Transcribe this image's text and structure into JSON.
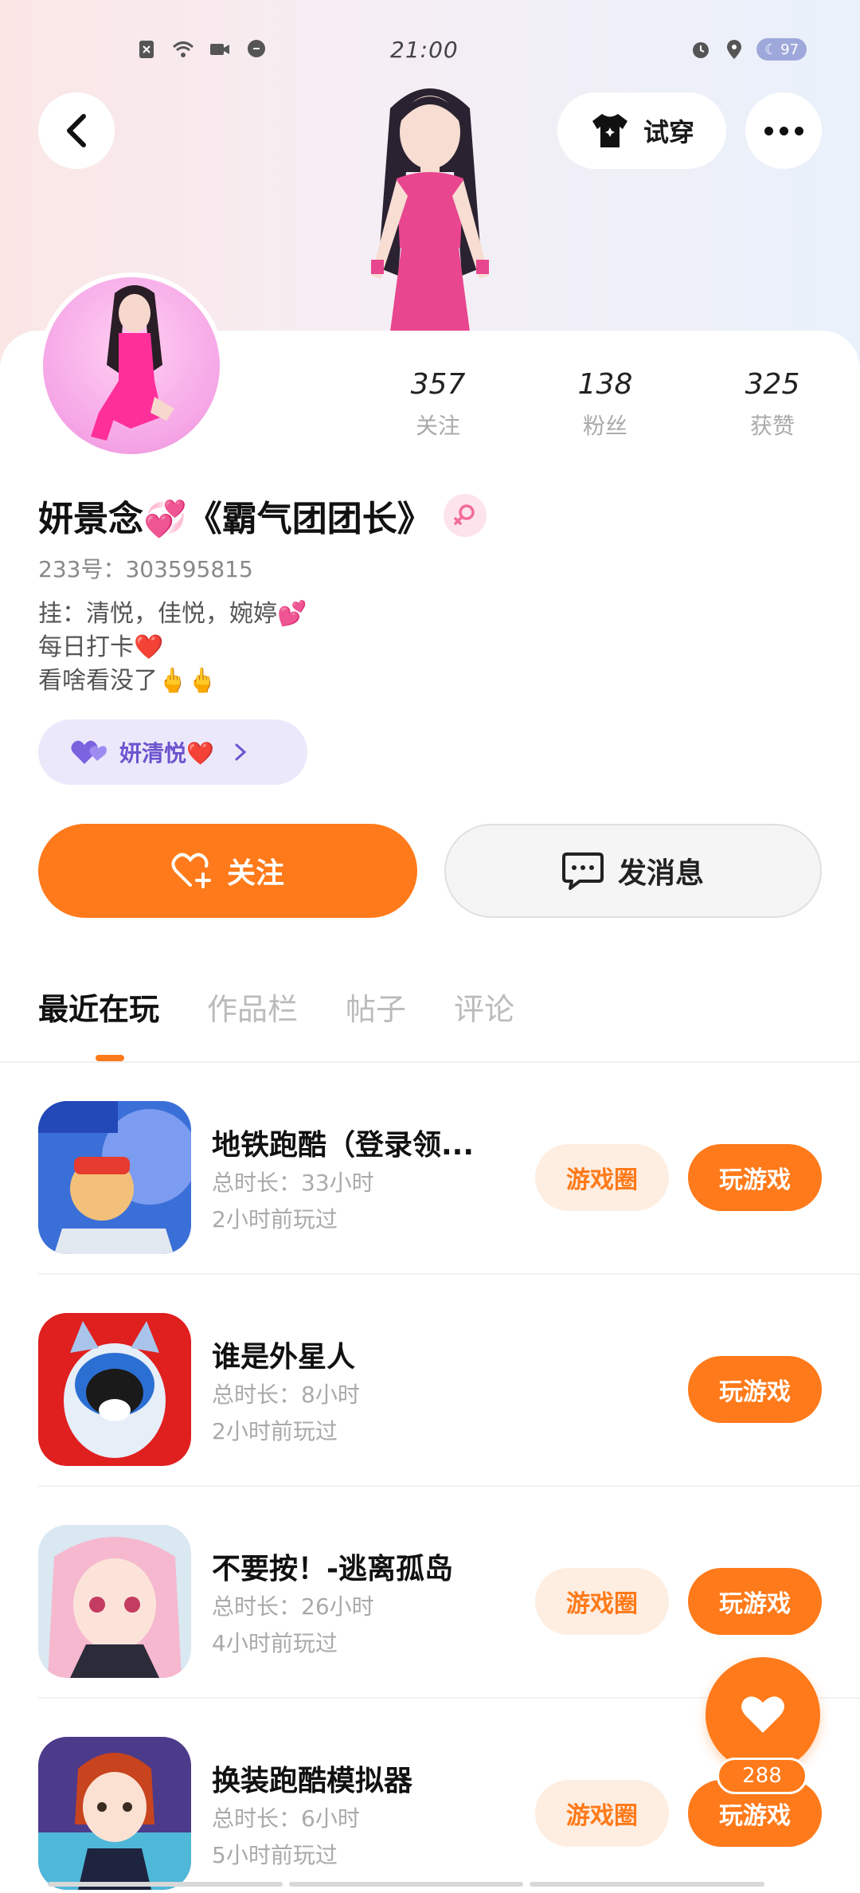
{
  "status_bar": {
    "time": "21:00",
    "battery": "97",
    "left_icons": [
      "sim-off-icon",
      "wifi-icon",
      "video-icon",
      "chat-bubble-icon"
    ],
    "right_icons": [
      "alarm-icon",
      "location-icon",
      "moon-battery-icon"
    ]
  },
  "header": {
    "tryon_label": "试穿"
  },
  "profile": {
    "name": "妍景念💞《霸气团团长》",
    "uid": "233号：303595815",
    "bio_lines": [
      "挂：清悦，佳悦，婉婷💕",
      "每日打卡❤️",
      "看啥看没了🖕🖕"
    ],
    "friend_chip": "妍清悦❤️",
    "stats": [
      {
        "value": "357",
        "label": "关注"
      },
      {
        "value": "138",
        "label": "粉丝"
      },
      {
        "value": "325",
        "label": "获赞"
      }
    ]
  },
  "actions": {
    "follow_label": "关注",
    "message_label": "发消息"
  },
  "tabs": [
    {
      "label": "最近在玩",
      "active": true
    },
    {
      "label": "作品栏",
      "active": false
    },
    {
      "label": "帖子",
      "active": false
    },
    {
      "label": "评论",
      "active": false
    }
  ],
  "games": [
    {
      "title": "地铁跑酷（登录领...",
      "total": "总时长：33小时",
      "last": "2小时前玩过",
      "has_circle": true,
      "circle_label": "游戏圈",
      "play_label": "玩游戏"
    },
    {
      "title": "谁是外星人",
      "total": "总时长：8小时",
      "last": "2小时前玩过",
      "has_circle": false,
      "circle_label": "",
      "play_label": "玩游戏"
    },
    {
      "title": "不要按！-逃离孤岛",
      "total": "总时长：26小时",
      "last": "4小时前玩过",
      "has_circle": true,
      "circle_label": "游戏圈",
      "play_label": "玩游戏"
    },
    {
      "title": "换装跑酷模拟器",
      "total": "总时长：6小时",
      "last": "5小时前玩过",
      "has_circle": true,
      "circle_label": "游戏圈",
      "play_label": "玩游戏"
    }
  ],
  "like_fab": {
    "count": "288"
  },
  "colors": {
    "accent": "#ff7a1a",
    "friend_chip_bg": "#ece8fb",
    "friend_chip_text": "#6b55cf"
  }
}
